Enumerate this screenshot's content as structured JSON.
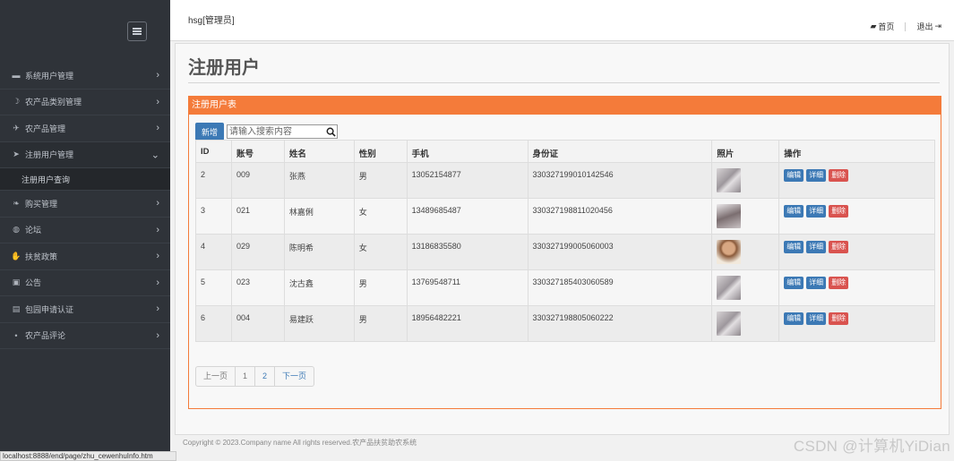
{
  "sidebar": {
    "items": [
      {
        "label": "系统用户管理",
        "icon": "user-icon",
        "glyph": "▬",
        "chevron": "›"
      },
      {
        "label": "农产品类别管理",
        "icon": "moon-icon",
        "glyph": "☽",
        "chevron": "›"
      },
      {
        "label": "农产品管理",
        "icon": "plane-icon",
        "glyph": "✈",
        "chevron": "›"
      },
      {
        "label": "注册用户管理",
        "icon": "send-icon",
        "glyph": "➤",
        "chevron": "⌄"
      },
      {
        "label": "购买管理",
        "icon": "leaf-icon",
        "glyph": "❧",
        "chevron": "›"
      },
      {
        "label": "论坛",
        "icon": "globe-icon",
        "glyph": "◍",
        "chevron": "›"
      },
      {
        "label": "扶贫政策",
        "icon": "hand-icon",
        "glyph": "✋",
        "chevron": "›"
      },
      {
        "label": "公告",
        "icon": "briefcase-icon",
        "glyph": "▣",
        "chevron": "›"
      },
      {
        "label": "包园申请认证",
        "icon": "suitcase-icon",
        "glyph": "▤",
        "chevron": "›"
      },
      {
        "label": "农产品评论",
        "icon": "dot-icon",
        "glyph": "•",
        "chevron": "›"
      }
    ],
    "sub_item": "注册用户查询",
    "status_url": "localhost:8888/end/page/zhu_cewenhuInfo.htm"
  },
  "header": {
    "user": "hsg[管理员]",
    "home": "首页",
    "logout": "退出"
  },
  "main": {
    "title": "注册用户",
    "panel_title": "注册用户表",
    "add_label": "新增",
    "search_placeholder": "请输入搜索内容",
    "columns": [
      "ID",
      "账号",
      "姓名",
      "性别",
      "手机",
      "身份证",
      "照片",
      "操作"
    ],
    "rows": [
      {
        "id": "2",
        "account": "009",
        "name": "张燕",
        "gender": "男",
        "phone": "13052154877",
        "idcard": "330327199010142546",
        "photo": "gray"
      },
      {
        "id": "3",
        "account": "021",
        "name": "林嘉俐",
        "gender": "女",
        "phone": "13489685487",
        "idcard": "330327198811020456",
        "photo": "dark"
      },
      {
        "id": "4",
        "account": "029",
        "name": "陈明希",
        "gender": "女",
        "phone": "13186835580",
        "idcard": "330327199005060003",
        "photo": "warm"
      },
      {
        "id": "5",
        "account": "023",
        "name": "沈古鑫",
        "gender": "男",
        "phone": "13769548711",
        "idcard": "330327185403060589",
        "photo": "gray"
      },
      {
        "id": "6",
        "account": "004",
        "name": "易建跃",
        "gender": "男",
        "phone": "18956482221",
        "idcard": "330327198805060222",
        "photo": "gray"
      }
    ],
    "actions": {
      "edit": "编辑",
      "detail": "详细",
      "delete": "删除"
    },
    "pager": {
      "prev": "上一页",
      "page1": "1",
      "page2": "2",
      "next": "下一页"
    }
  },
  "footer": "Copyright © 2023.Company name All rights reserved.农产品扶贫助农系统",
  "watermark": "CSDN @计算机YiDian",
  "colors": {
    "sidebar": "#2f3339",
    "accent": "#f47b3a",
    "primary": "#3c79b5",
    "danger": "#d9534f"
  }
}
